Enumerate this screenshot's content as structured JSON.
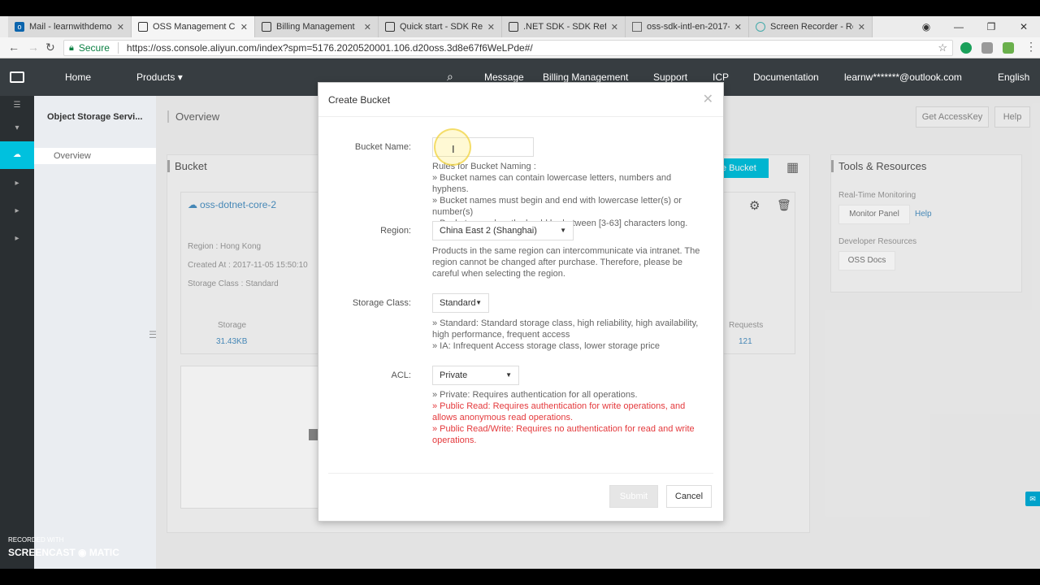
{
  "browser": {
    "tabs": [
      {
        "title": "Mail - learnwithdemo@",
        "icon": "mail-icon"
      },
      {
        "title": "OSS Management Con",
        "icon": "aliyun-icon"
      },
      {
        "title": "Billing Management",
        "icon": "aliyun-icon"
      },
      {
        "title": "Quick start - SDK Refer",
        "icon": "aliyun-icon"
      },
      {
        "title": ".NET SDK - SDK Refere",
        "icon": "aliyun-icon"
      },
      {
        "title": "oss-sdk-intl-en-2017-",
        "icon": "document-icon"
      },
      {
        "title": "Screen Recorder - Reco",
        "icon": "screencast-icon"
      }
    ],
    "secure_label": "Secure",
    "url": "https://oss.console.aliyun.com/index?spm=5176.2020520001.106.d20oss.3d8e67f6WeLPde#/"
  },
  "header": {
    "nav": [
      "Home",
      "Products ▾",
      "Message",
      "Billing Management",
      "Support",
      "ICP",
      "Documentation",
      "learnw*******@outlook.com",
      "English"
    ]
  },
  "sidebar": {
    "title": "Object Storage Servi...",
    "items": [
      "Overview"
    ]
  },
  "main": {
    "breadcrumb": "Overview",
    "buttons": {
      "get_access_key": "Get AccessKey",
      "help": "Help"
    },
    "bucket_panel": {
      "title": "Bucket",
      "create_button_partial": "e Bucket",
      "bucket_name": "oss-dotnet-core-2",
      "region": "Region : Hong Kong",
      "created": "Created At : 2017-11-05 15:50:10",
      "storage_class": "Storage Class : Standard",
      "storage_label": "Storage",
      "storage_value": "31.43KB",
      "requests_label": "Requests",
      "requests_value": "121"
    },
    "tools": {
      "title": "Tools & Resources",
      "realtime_label": "Real-Time Monitoring",
      "monitor_panel": "Monitor Panel",
      "help": "Help",
      "dev_label": "Developer Resources",
      "oss_docs": "OSS Docs"
    }
  },
  "modal": {
    "title": "Create Bucket",
    "bucket_name_label": "Bucket Name:",
    "bucket_name_value": "",
    "naming_rules": [
      "Rules for Bucket Naming :",
      "» Bucket names can contain lowercase letters, numbers and hyphens.",
      "» Bucket names must begin and end with lowercase letter(s) or number(s)",
      "» Bucket name length should be between [3-63] characters long."
    ],
    "region_label": "Region:",
    "region_value": "China East 2 (Shanghai)",
    "region_hint": "Products in the same region can intercommunicate via intranet. The region cannot be changed after purchase. Therefore, please be careful when selecting the region.",
    "storage_label": "Storage Class:",
    "storage_value": "Standard",
    "storage_hints": [
      "» Standard: Standard storage class, high reliability, high availability, high performance, frequent access",
      "» IA: Infrequent Access storage class, lower storage price"
    ],
    "acl_label": "ACL:",
    "acl_value": "Private",
    "acl_hints": [
      "» Private: Requires authentication for all operations.",
      "» Public Read: Requires authentication for write operations, and allows anonymous read operations.",
      "» Public Read/Write: Requires no authentication for read and write operations."
    ],
    "submit_label": "Submit",
    "cancel_label": "Cancel"
  },
  "watermark": {
    "line1": "RECORDED WITH",
    "line2": "SCREENCAST ◉ MATIC"
  }
}
